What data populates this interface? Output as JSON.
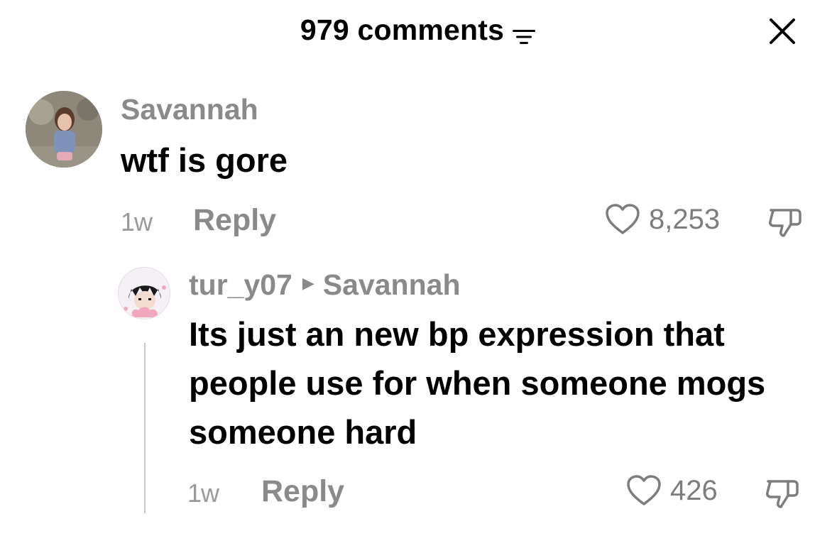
{
  "header": {
    "title": "979 comments",
    "sort_icon": "sort-lines-icon",
    "close_icon": "close-icon"
  },
  "comments": [
    {
      "username": "Savannah",
      "text": "wtf is gore",
      "time": "1w",
      "reply_label": "Reply",
      "likes": "8,253",
      "avatar_icon": "avatar-photo"
    }
  ],
  "replies": [
    {
      "username": "tur_y07",
      "reply_to": "Savannah",
      "text": "Its just an new bp expression that people use for when someone mogs someone hard",
      "time": "1w",
      "reply_label": "Reply",
      "likes": "426",
      "avatar_icon": "avatar-photo"
    }
  ],
  "colors": {
    "text": "#000000",
    "muted": "#8a8a8a",
    "background": "#ffffff"
  }
}
